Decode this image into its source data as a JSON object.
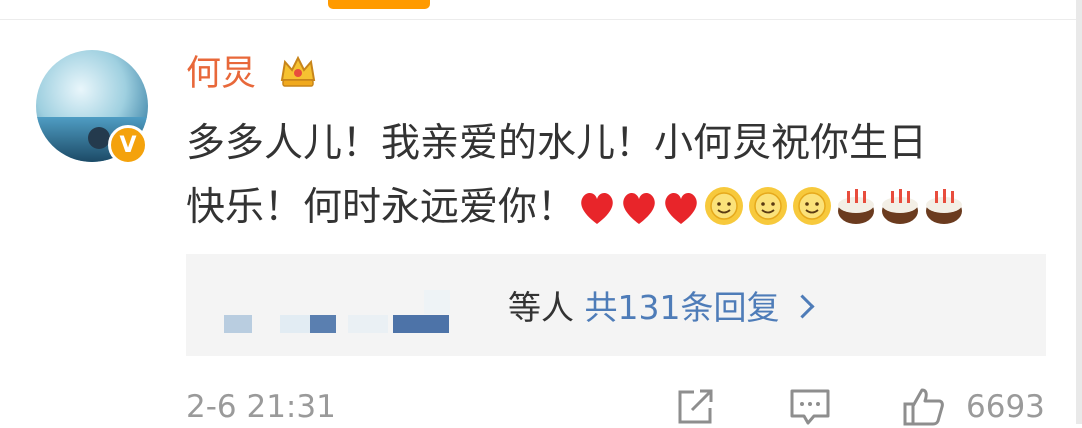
{
  "comment": {
    "username": "何炅",
    "text_line1": "多多人儿！我亲爱的水儿！小何炅祝你生日",
    "text_line2": "快乐！何时永远爱你！",
    "emojis": {
      "heart": "heart-emoji",
      "sunflower": "sunflower-smile-emoji",
      "cake": "birthday-cake-emoji"
    },
    "timestamp": "2-6 21:31",
    "like_count": "6693"
  },
  "replies": {
    "names_suffix": "等人",
    "link_text": "共131条回复"
  },
  "icons": {
    "badge": "verified-v-icon",
    "crown": "crown-icon",
    "share": "share-icon",
    "comment": "comment-icon",
    "like": "thumbs-up-icon"
  },
  "colors": {
    "accent": "#ff9a00",
    "username": "#e8683a",
    "link": "#4e7cb8",
    "meta": "#9a9a9a"
  }
}
